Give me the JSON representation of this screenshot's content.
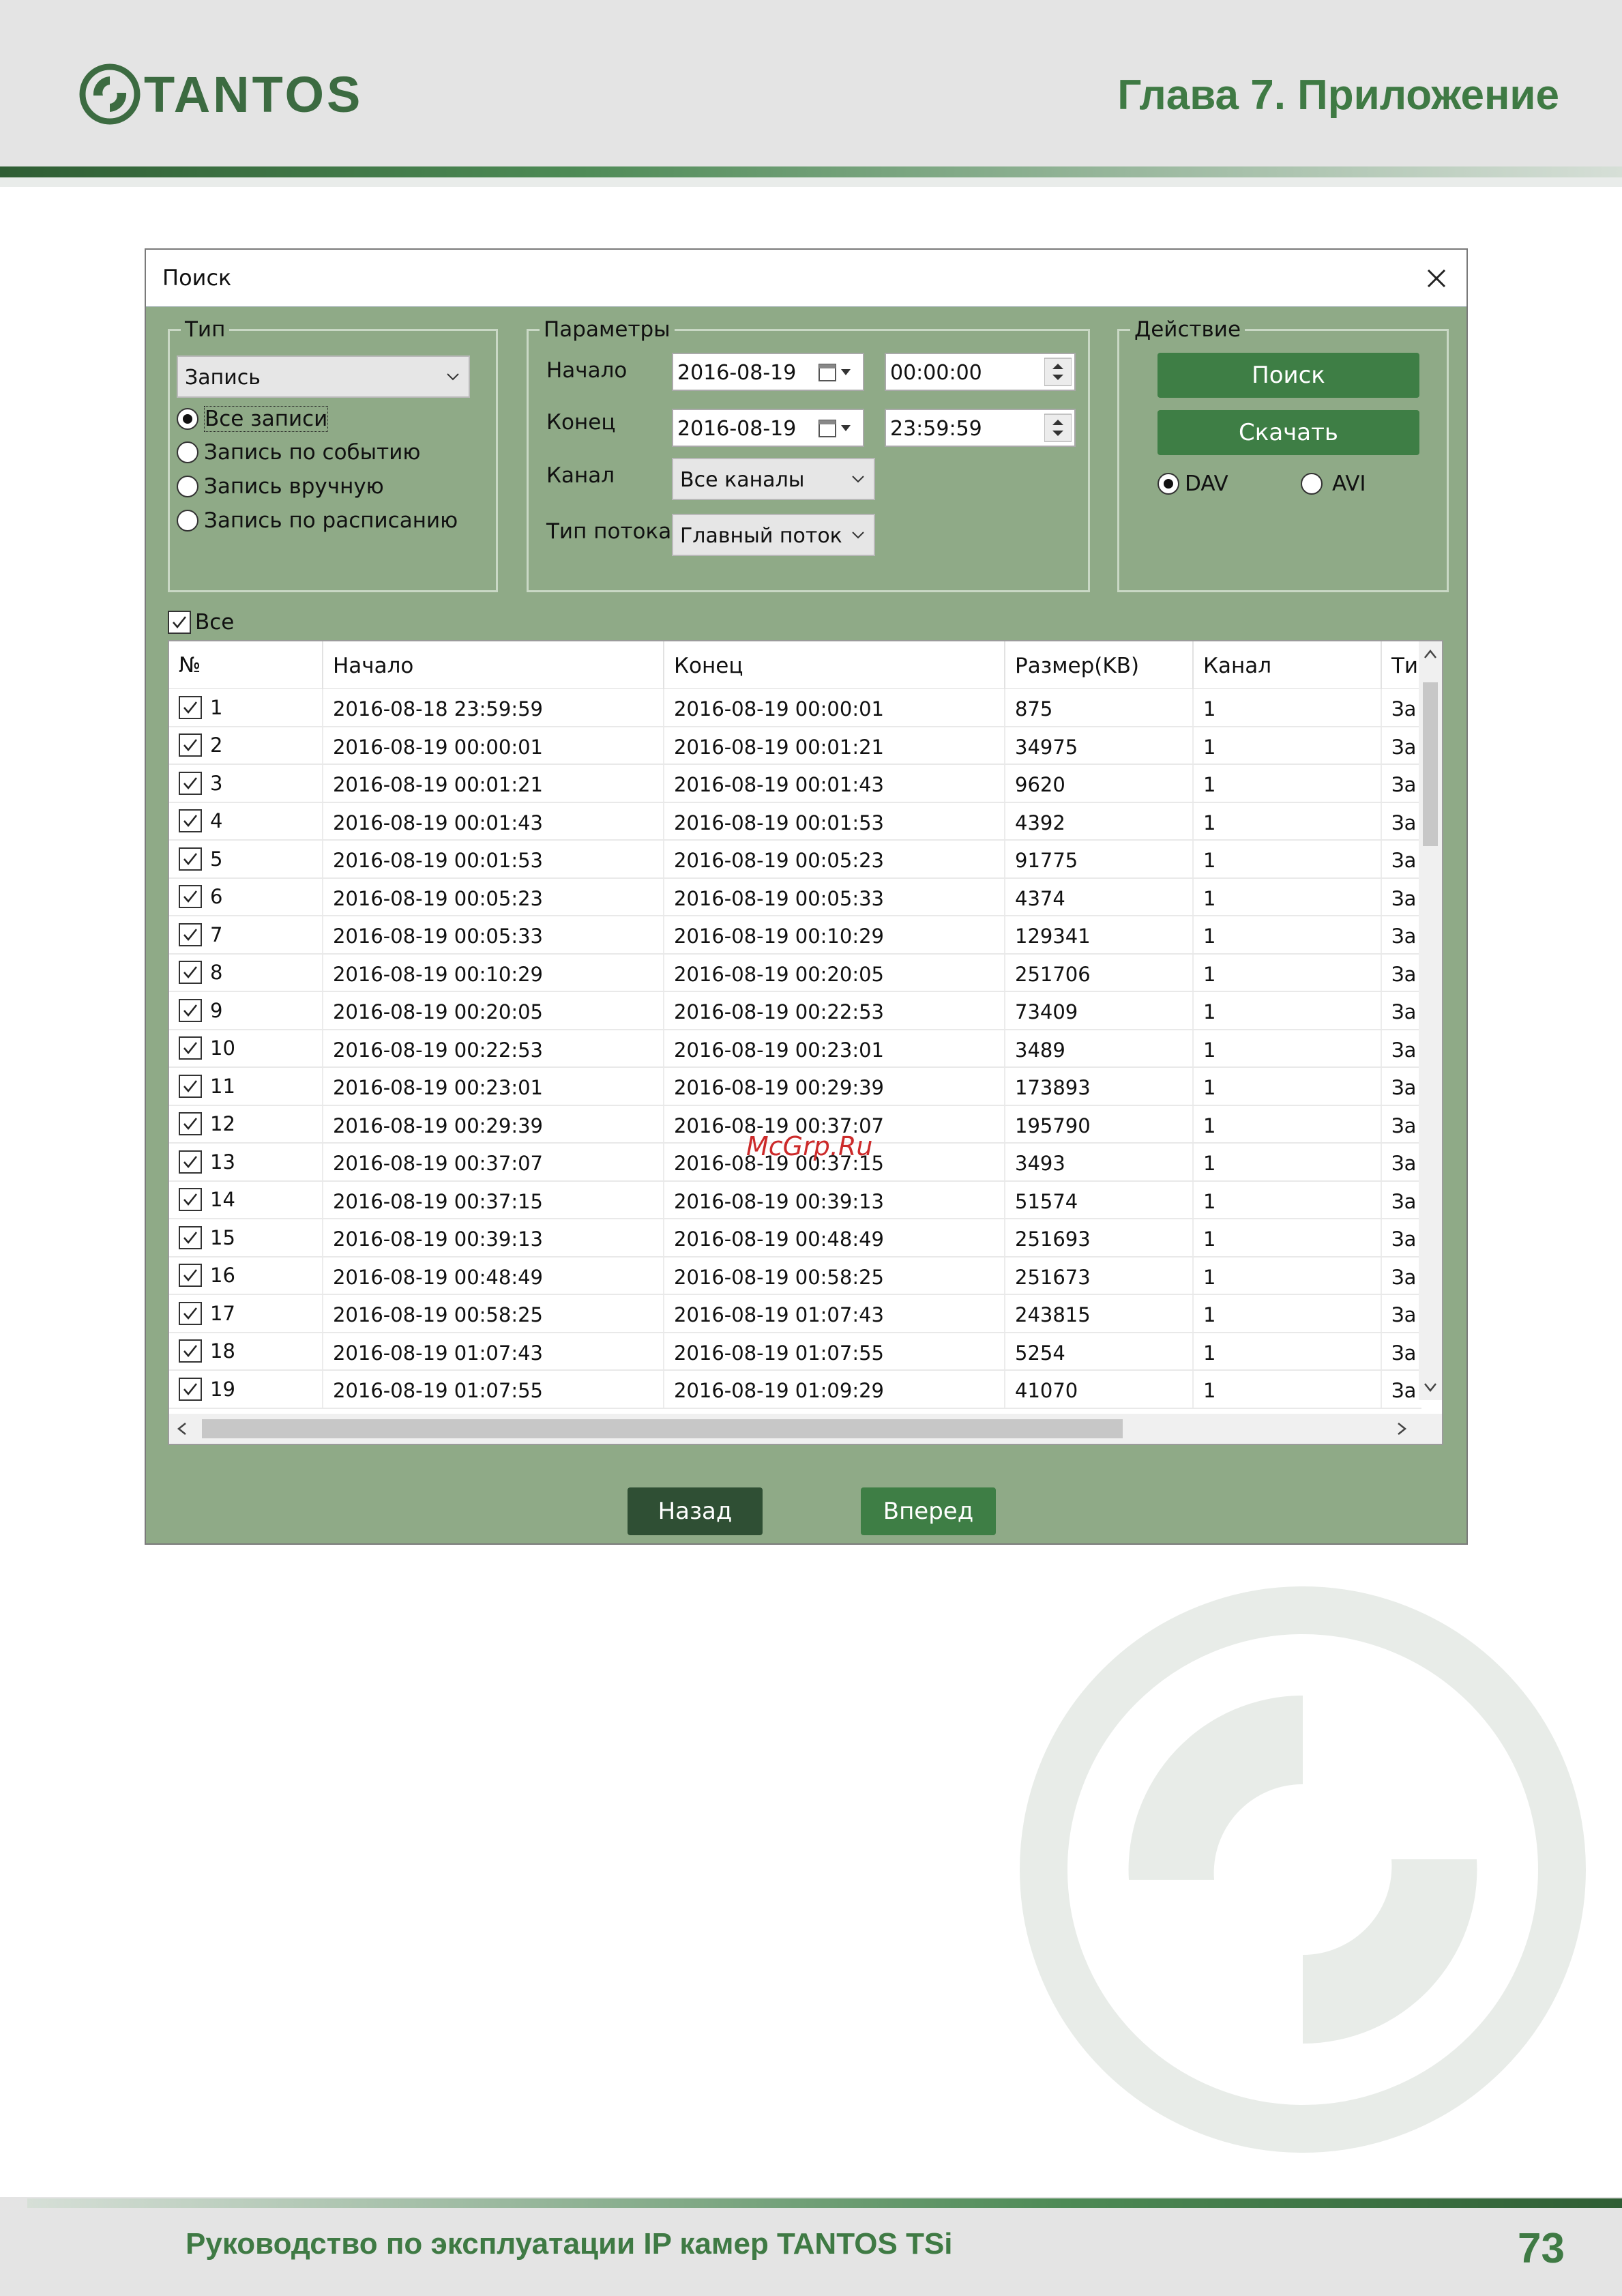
{
  "header": {
    "logo_text": "TANTOS",
    "chapter": "Глава 7. Приложение"
  },
  "dialog": {
    "title": "Поиск",
    "type_group": {
      "label": "Тип",
      "selected": "Запись",
      "options": [
        "Все записи",
        "Запись по событию",
        "Запись вручную",
        "Запись по расписанию"
      ],
      "checked_option": "Все записи"
    },
    "params_group": {
      "label": "Параметры",
      "start_label": "Начало",
      "start_date": "2016-08-19",
      "start_time": "00:00:00",
      "end_label": "Конец",
      "end_date": "2016-08-19",
      "end_time": "23:59:59",
      "channel_label": "Канал",
      "channel_value": "Все каналы",
      "stream_label": "Тип потока",
      "stream_value": "Главный поток"
    },
    "action_group": {
      "label": "Действие",
      "search_button": "Поиск",
      "download_button": "Скачать",
      "format_dav": "DAV",
      "format_avi": "AVI",
      "selected_format": "DAV"
    },
    "select_all_label": "Все",
    "table": {
      "columns": [
        "№",
        "Начало",
        "Конец",
        "Размер(KB)",
        "Канал",
        "Ти"
      ],
      "rows": [
        {
          "n": "1",
          "start": "2016-08-18 23:59:59",
          "end": "2016-08-19 00:00:01",
          "size": "875",
          "ch": "1",
          "type": "За"
        },
        {
          "n": "2",
          "start": "2016-08-19 00:00:01",
          "end": "2016-08-19 00:01:21",
          "size": "34975",
          "ch": "1",
          "type": "За"
        },
        {
          "n": "3",
          "start": "2016-08-19 00:01:21",
          "end": "2016-08-19 00:01:43",
          "size": "9620",
          "ch": "1",
          "type": "За"
        },
        {
          "n": "4",
          "start": "2016-08-19 00:01:43",
          "end": "2016-08-19 00:01:53",
          "size": "4392",
          "ch": "1",
          "type": "За"
        },
        {
          "n": "5",
          "start": "2016-08-19 00:01:53",
          "end": "2016-08-19 00:05:23",
          "size": "91775",
          "ch": "1",
          "type": "За"
        },
        {
          "n": "6",
          "start": "2016-08-19 00:05:23",
          "end": "2016-08-19 00:05:33",
          "size": "4374",
          "ch": "1",
          "type": "За"
        },
        {
          "n": "7",
          "start": "2016-08-19 00:05:33",
          "end": "2016-08-19 00:10:29",
          "size": "129341",
          "ch": "1",
          "type": "За"
        },
        {
          "n": "8",
          "start": "2016-08-19 00:10:29",
          "end": "2016-08-19 00:20:05",
          "size": "251706",
          "ch": "1",
          "type": "За"
        },
        {
          "n": "9",
          "start": "2016-08-19 00:20:05",
          "end": "2016-08-19 00:22:53",
          "size": "73409",
          "ch": "1",
          "type": "За"
        },
        {
          "n": "10",
          "start": "2016-08-19 00:22:53",
          "end": "2016-08-19 00:23:01",
          "size": "3489",
          "ch": "1",
          "type": "За"
        },
        {
          "n": "11",
          "start": "2016-08-19 00:23:01",
          "end": "2016-08-19 00:29:39",
          "size": "173893",
          "ch": "1",
          "type": "За"
        },
        {
          "n": "12",
          "start": "2016-08-19 00:29:39",
          "end": "2016-08-19 00:37:07",
          "size": "195790",
          "ch": "1",
          "type": "За"
        },
        {
          "n": "13",
          "start": "2016-08-19 00:37:07",
          "end": "2016-08-19 00:37:15",
          "size": "3493",
          "ch": "1",
          "type": "За"
        },
        {
          "n": "14",
          "start": "2016-08-19 00:37:15",
          "end": "2016-08-19 00:39:13",
          "size": "51574",
          "ch": "1",
          "type": "За"
        },
        {
          "n": "15",
          "start": "2016-08-19 00:39:13",
          "end": "2016-08-19 00:48:49",
          "size": "251693",
          "ch": "1",
          "type": "За"
        },
        {
          "n": "16",
          "start": "2016-08-19 00:48:49",
          "end": "2016-08-19 00:58:25",
          "size": "251673",
          "ch": "1",
          "type": "За"
        },
        {
          "n": "17",
          "start": "2016-08-19 00:58:25",
          "end": "2016-08-19 01:07:43",
          "size": "243815",
          "ch": "1",
          "type": "За"
        },
        {
          "n": "18",
          "start": "2016-08-19 01:07:43",
          "end": "2016-08-19 01:07:55",
          "size": "5254",
          "ch": "1",
          "type": "За"
        },
        {
          "n": "19",
          "start": "2016-08-19 01:07:55",
          "end": "2016-08-19 01:09:29",
          "size": "41070",
          "ch": "1",
          "type": "За"
        }
      ]
    },
    "back_button": "Назад",
    "forward_button": "Вперед"
  },
  "watermark": "McGrp.Ru",
  "footer": {
    "text": "Руководство по эксплуатации IP камер TANTOS TSi",
    "page": "73"
  },
  "colors": {
    "brand_green": "#3f7a44",
    "dialog_bg": "#8faa87",
    "button_green": "#3e7e45",
    "button_dark": "#2f4f34"
  }
}
